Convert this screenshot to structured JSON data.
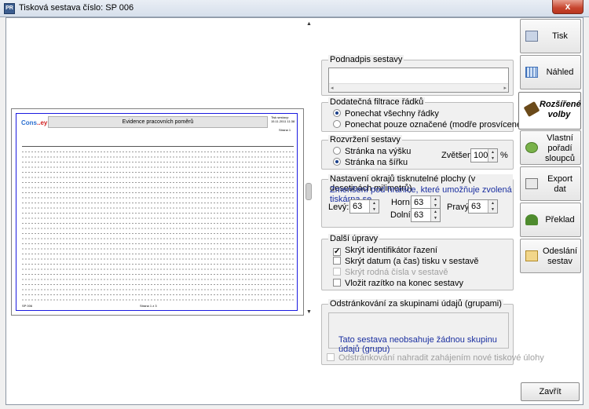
{
  "window": {
    "title": "Tisková sestava číslo:  SP 006",
    "close_symbol": "x"
  },
  "preview": {
    "logo_main": "Cons",
    "logo_accent": "..ey",
    "report_title": "Evidence pracovních poměrů",
    "header_right": "Tisk sestavy: 15.11.2011 11:38",
    "header_right2": "Strana 1",
    "footer_left": "SP 006",
    "footer_mid": "Strana 1 z 3"
  },
  "subtitle_group": {
    "legend": "Podnadpis sestavy",
    "value": "",
    "scroll_left": "◂",
    "scroll_right": "▸"
  },
  "filter_group": {
    "legend": "Dodatečná filtrace řádků",
    "options": [
      {
        "label": "Ponechat všechny řádky",
        "selected": true
      },
      {
        "label": "Ponechat pouze označené (modře prosvícené) řádky",
        "selected": false
      }
    ]
  },
  "layout_group": {
    "legend": "Rozvržení sestavy",
    "options": [
      {
        "label": "Stránka na výšku",
        "selected": false
      },
      {
        "label": "Stránka na šířku",
        "selected": true
      }
    ],
    "zoom_label": "Zvětšení:",
    "zoom_value": "100",
    "zoom_unit": "%"
  },
  "margins_group": {
    "legend": "Nastavení okrajů tisknutelné plochy (v desetinách milimetrů)",
    "hint": "Zmenšení pod hranice, které umožňuje zvolená tiskárna se",
    "left_label": "Levý:",
    "left_value": "63",
    "top_label": "Horní:",
    "top_value": "63",
    "bottom_label": "Dolní:",
    "bottom_value": "63",
    "right_label": "Pravý:",
    "right_value": "63"
  },
  "extras_group": {
    "legend": "Další úpravy",
    "items": [
      {
        "label": "Skrýt identifikátor řazení",
        "checked": true,
        "enabled": true
      },
      {
        "label": "Skrýt datum (a čas) tisku v sestavě",
        "checked": false,
        "enabled": true
      },
      {
        "label": "Skrýt rodná čísla v sestavě",
        "checked": false,
        "enabled": false
      },
      {
        "label": "Vložit razítko na konec sestavy",
        "checked": false,
        "enabled": true
      }
    ]
  },
  "paging_group": {
    "legend": "Odstránkování za skupinami údajů (grupami)",
    "message": "Tato sestava neobsahuje žádnou skupinu údajů (grupu)",
    "replace_label": "Odstránkování nahradit zahájením nové tiskové úlohy"
  },
  "tabs": [
    {
      "label": "Tisk",
      "icon": "printer-icon"
    },
    {
      "label": "Náhled",
      "icon": "preview-grid-icon"
    },
    {
      "label": "Rozšířené volby",
      "icon": "tools-icon",
      "active": true
    },
    {
      "label": "Vlastní pořadí sloupců",
      "icon": "column-order-icon"
    },
    {
      "label": "Export dat",
      "icon": "export-icon"
    },
    {
      "label": "Překlad",
      "icon": "translate-icon"
    },
    {
      "label": "Odeslání sestav",
      "icon": "send-mail-icon"
    }
  ],
  "close_button": "Zavřít",
  "check_mark": "✓"
}
